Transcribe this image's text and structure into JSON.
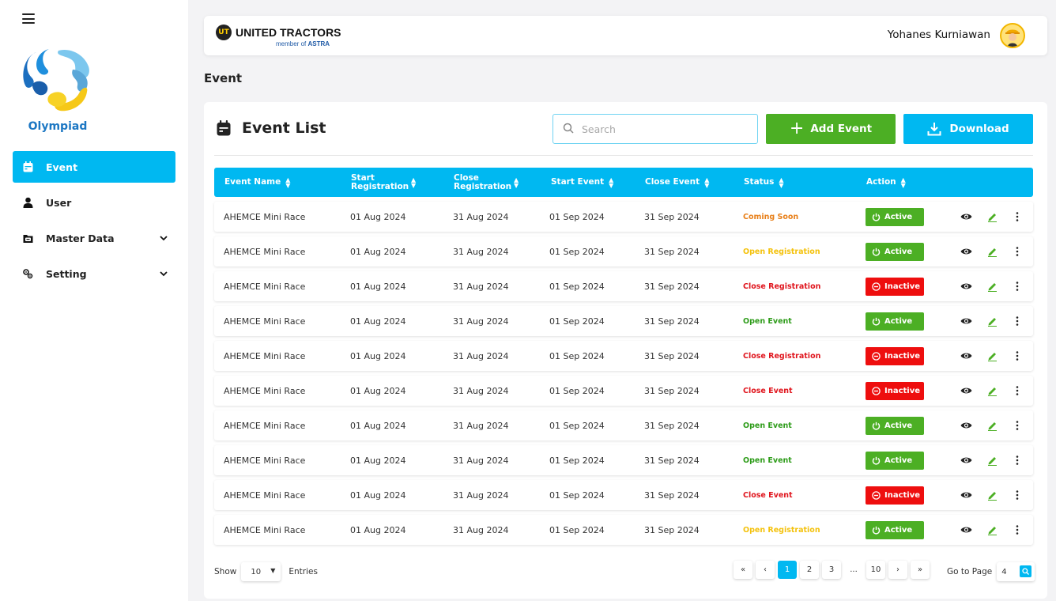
{
  "sidebar": {
    "brand": "Olympiad",
    "items": [
      {
        "label": "Event",
        "icon": "calendar-icon",
        "active": true
      },
      {
        "label": "User",
        "icon": "user-icon"
      },
      {
        "label": "Master Data",
        "icon": "folder-icon",
        "expandable": true
      },
      {
        "label": "Setting",
        "icon": "gears-icon",
        "expandable": true
      }
    ]
  },
  "header": {
    "company": "UNITED TRACTORS",
    "company_sub_prefix": "member of",
    "company_sub_brand": "ASTRA",
    "user_name": "Yohanes Kurniawan"
  },
  "page": {
    "title": "Event"
  },
  "card": {
    "title": "Event List",
    "search_placeholder": "Search",
    "add_label": "Add Event",
    "download_label": "Download"
  },
  "table": {
    "columns": [
      {
        "label": "Event Name"
      },
      {
        "label": "Start Registration"
      },
      {
        "label": "Close Registration"
      },
      {
        "label": "Start Event"
      },
      {
        "label": "Close Event"
      },
      {
        "label": "Status"
      },
      {
        "label": "Action"
      }
    ],
    "rows": [
      {
        "name": "AHEMCE Mini Race",
        "start_reg": "01 Aug 2024",
        "close_reg": "31 Aug 2024",
        "start_event": "01 Sep 2024",
        "close_event": "31 Sep 2024",
        "status": "Coming Soon",
        "status_color": "#e8801a",
        "active": "Active"
      },
      {
        "name": "AHEMCE Mini Race",
        "start_reg": "01 Aug 2024",
        "close_reg": "31 Aug 2024",
        "start_event": "01 Sep 2024",
        "close_event": "31 Sep 2024",
        "status": "Open Registration",
        "status_color": "#f4c20d",
        "active": "Active"
      },
      {
        "name": "AHEMCE Mini Race",
        "start_reg": "01 Aug 2024",
        "close_reg": "31 Aug 2024",
        "start_event": "01 Sep 2024",
        "close_event": "31 Sep 2024",
        "status": "Close Registration",
        "status_color": "#e0161e",
        "active": "Inactive"
      },
      {
        "name": "AHEMCE Mini Race",
        "start_reg": "01 Aug 2024",
        "close_reg": "31 Aug 2024",
        "start_event": "01 Sep 2024",
        "close_event": "31 Sep 2024",
        "status": "Open Event",
        "status_color": "#2e9c1a",
        "active": "Active"
      },
      {
        "name": "AHEMCE Mini Race",
        "start_reg": "01 Aug 2024",
        "close_reg": "31 Aug 2024",
        "start_event": "01 Sep 2024",
        "close_event": "31 Sep 2024",
        "status": "Close Registration",
        "status_color": "#e0161e",
        "active": "Inactive"
      },
      {
        "name": "AHEMCE Mini Race",
        "start_reg": "01 Aug 2024",
        "close_reg": "31 Aug 2024",
        "start_event": "01 Sep 2024",
        "close_event": "31 Sep 2024",
        "status": "Close Event",
        "status_color": "#e0161e",
        "active": "Inactive"
      },
      {
        "name": "AHEMCE Mini Race",
        "start_reg": "01 Aug 2024",
        "close_reg": "31 Aug 2024",
        "start_event": "01 Sep 2024",
        "close_event": "31 Sep 2024",
        "status": "Open Event",
        "status_color": "#2e9c1a",
        "active": "Active"
      },
      {
        "name": "AHEMCE Mini Race",
        "start_reg": "01 Aug 2024",
        "close_reg": "31 Aug 2024",
        "start_event": "01 Sep 2024",
        "close_event": "31 Sep 2024",
        "status": "Open Event",
        "status_color": "#2e9c1a",
        "active": "Active"
      },
      {
        "name": "AHEMCE Mini Race",
        "start_reg": "01 Aug 2024",
        "close_reg": "31 Aug 2024",
        "start_event": "01 Sep 2024",
        "close_event": "31 Sep 2024",
        "status": "Close Event",
        "status_color": "#e0161e",
        "active": "Inactive"
      },
      {
        "name": "AHEMCE Mini Race",
        "start_reg": "01 Aug 2024",
        "close_reg": "31 Aug 2024",
        "start_event": "01 Sep 2024",
        "close_event": "31 Sep 2024",
        "status": "Open Registration",
        "status_color": "#f4c20d",
        "active": "Active"
      }
    ]
  },
  "footer": {
    "show_label": "Show",
    "page_size": "10",
    "entries_label": "Entries",
    "pages": [
      "1",
      "2",
      "3",
      "...",
      "10"
    ],
    "current_page": "1",
    "goto_label": "Go to Page",
    "goto_value": "4"
  },
  "colors": {
    "accent": "#00b8f1",
    "active_green": "#4caf24",
    "inactive_red": "#ee0e0e"
  }
}
